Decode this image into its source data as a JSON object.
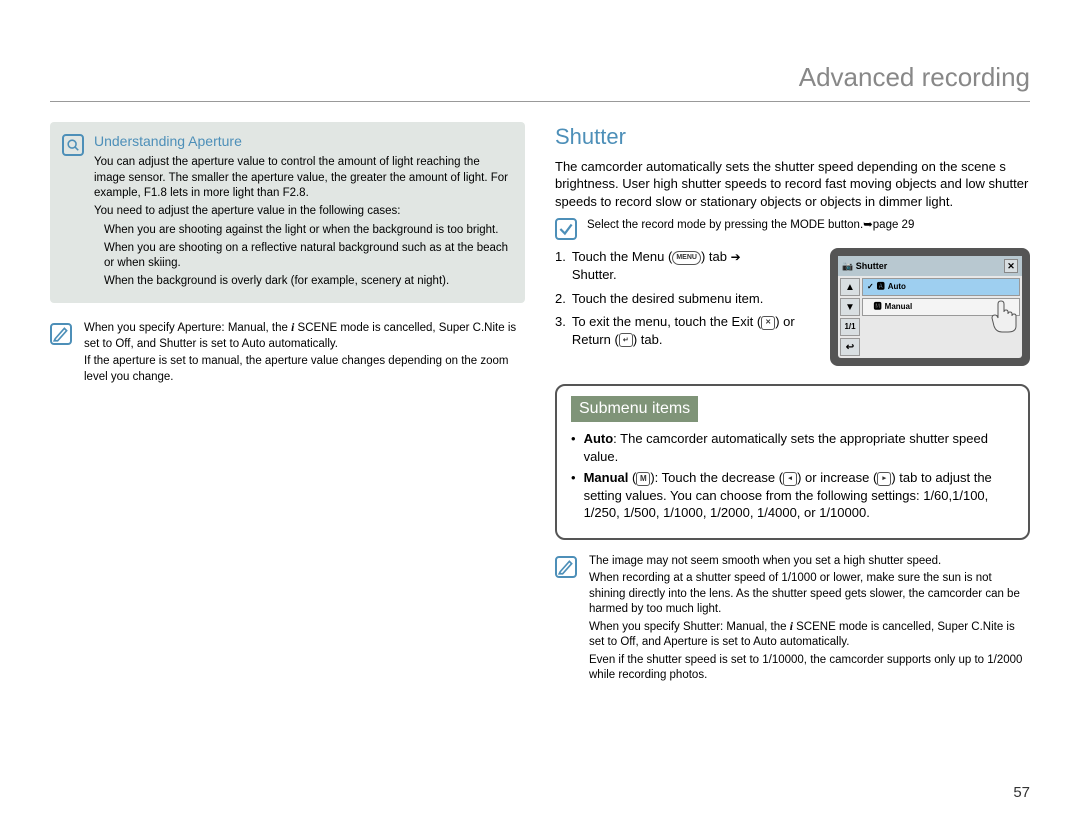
{
  "header": {
    "title": "Advanced recording"
  },
  "left": {
    "aperture": {
      "title": "Understanding Aperture",
      "p1": "You can adjust the aperture value to control the amount of light reaching the image sensor. The smaller the aperture value, the greater the amount of light. For example, F1.8 lets in more light than F2.8.",
      "p2": "You need to adjust the aperture value in the following cases:",
      "c1": "When you are shooting against the light or when the background is too bright.",
      "c2": "When you are shooting on a reflective natural background such as at the beach or when skiing.",
      "c3": "When the background is overly dark (for example, scenery at night)."
    },
    "note": {
      "n1a": "When you specify  Aperture: Manual,  the ",
      "n1b": "SCENE mode is cancelled,  Super C.Nite  is set to  Off,  and  Shutter  is set to  Auto  automatically.",
      "n2": "If the aperture is set to manual, the aperture value changes depending on the zoom level you change."
    }
  },
  "right": {
    "title": "Shutter",
    "intro": "The camcorder automatically sets the shutter speed depending on the scene s brightness. User high shutter speeds to record fast moving objects and low shutter speeds to record slow or stationary objects or objects in dimmer light.",
    "precheck": "Select the record mode by pressing the MODE button.➥page 29",
    "steps": {
      "s1a": "Touch the Menu ",
      "s1b": " tab ",
      "s1c": "Shutter.",
      "s2": "Touch the desired submenu item.",
      "s3a": "To exit the menu, touch the Exit ",
      "s3b": " or Return ",
      "s3c": " tab."
    },
    "screen": {
      "title": "Shutter",
      "opt1": "Auto",
      "opt2": "Manual",
      "side_chars": {
        "up": "▲",
        "down": "▼",
        "back": "↩",
        "close": "✕"
      }
    },
    "submenu": {
      "title": "Submenu items",
      "auto_label": "Auto",
      "auto_text": ": The camcorder automatically sets the appropriate shutter speed value.",
      "manual_label": "Manual",
      "manual_text1": ": Touch the decrease ",
      "manual_text2": " or increase ",
      "manual_text3": " tab to adjust the setting values. You can choose from the following settings: 1/60,1/100, 1/250, 1/500, 1/1000, 1/2000, 1/4000, or 1/10000."
    },
    "notes": {
      "n1": "The image may not seem smooth when you set a high shutter speed.",
      "n2": "When recording at a shutter speed of 1/1000 or lower, make sure the sun is not shining directly into the lens. As the shutter speed gets slower, the camcorder can be harmed by too much light.",
      "n3a": "When you specify  Shutter: Manual,  the ",
      "n3b": "SCENE mode is cancelled,  Super C.Nite  is set to  Off,  and  Aperture  is set to  Auto  automatically.",
      "n4": "Even if the shutter speed is set to 1/10000, the camcorder supports only up to 1/2000 while recording photos."
    }
  },
  "badges": {
    "menu": "MENU",
    "close": "✕",
    "return": "↵",
    "dec": "◂",
    "inc": "▸",
    "arrow": "➔",
    "manual_badge": "M",
    "check": "✓"
  },
  "page_number": "57"
}
